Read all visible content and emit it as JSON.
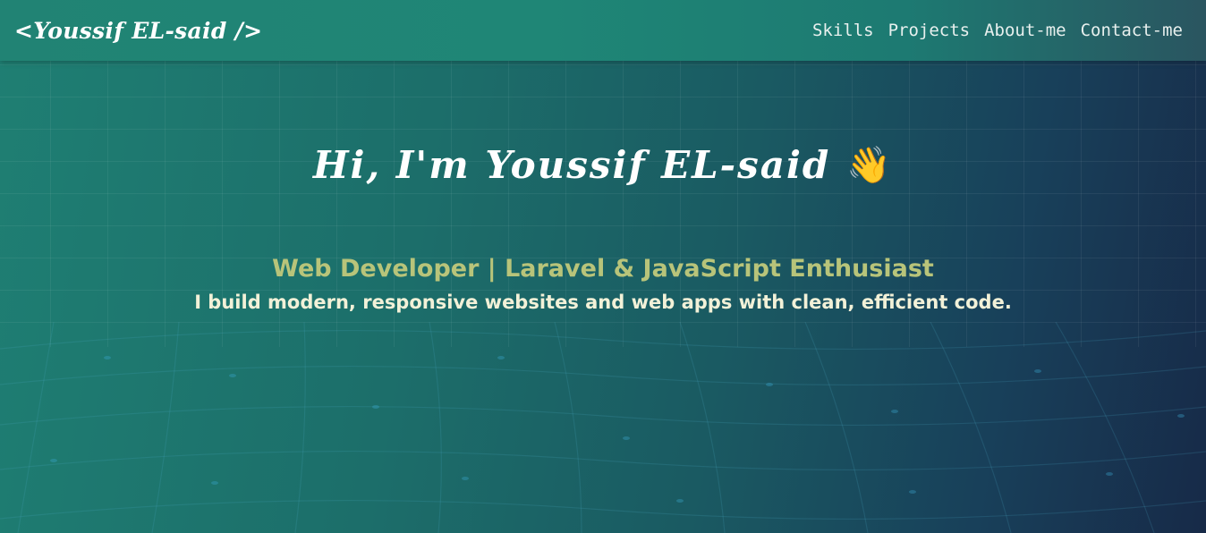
{
  "navbar": {
    "logo": "<Youssif EL-said />",
    "links": [
      "Skills",
      "Projects",
      "About-me",
      "Contact-me"
    ]
  },
  "hero": {
    "title": "Hi, I'm Youssif EL-said",
    "wave_icon": "waving-hand-icon",
    "wave_emoji": "👋",
    "subtitle": "Web Developer | Laravel & JavaScript Enthusiast",
    "description": "I build modern, responsive websites and web apps with clean, efficient code."
  },
  "colors": {
    "subtitle": "#b8c47a",
    "description": "#f2f1d8",
    "background_start": "#1f7f73",
    "background_end": "#172a48"
  }
}
